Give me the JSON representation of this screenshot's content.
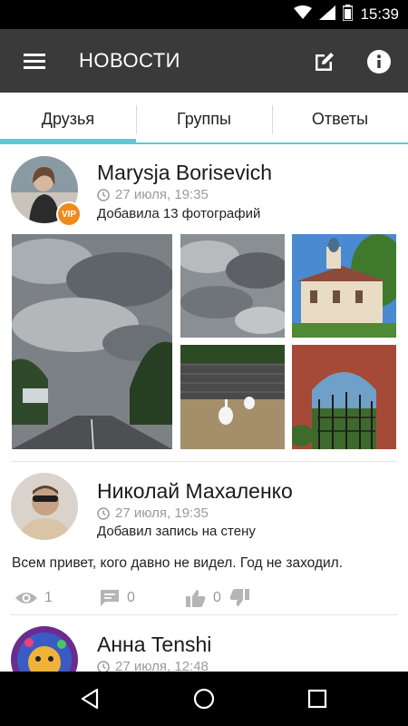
{
  "status_bar": {
    "time": "15:39"
  },
  "app_bar": {
    "title": "НОВОСТИ"
  },
  "tabs": [
    {
      "label": "Друзья",
      "active": true
    },
    {
      "label": "Группы",
      "active": false
    },
    {
      "label": "Ответы",
      "active": false
    }
  ],
  "accent_color": "#5ec8d6",
  "posts": [
    {
      "author": "Marysja Borisevich",
      "badge": "VIP",
      "time": "27 июля, 19:35",
      "action": "Добавила 13 фотографий"
    },
    {
      "author": "Николай Махаленко",
      "time": "27 июля, 19:35",
      "action": "Добавил запись на стену",
      "text": "Всем привет, кого давно не видел. Год не заходил.",
      "stats": {
        "views": "1",
        "comments": "0",
        "likes": "0"
      }
    },
    {
      "author": "Анна Tenshi",
      "time": "27 июля, 12:48"
    }
  ]
}
